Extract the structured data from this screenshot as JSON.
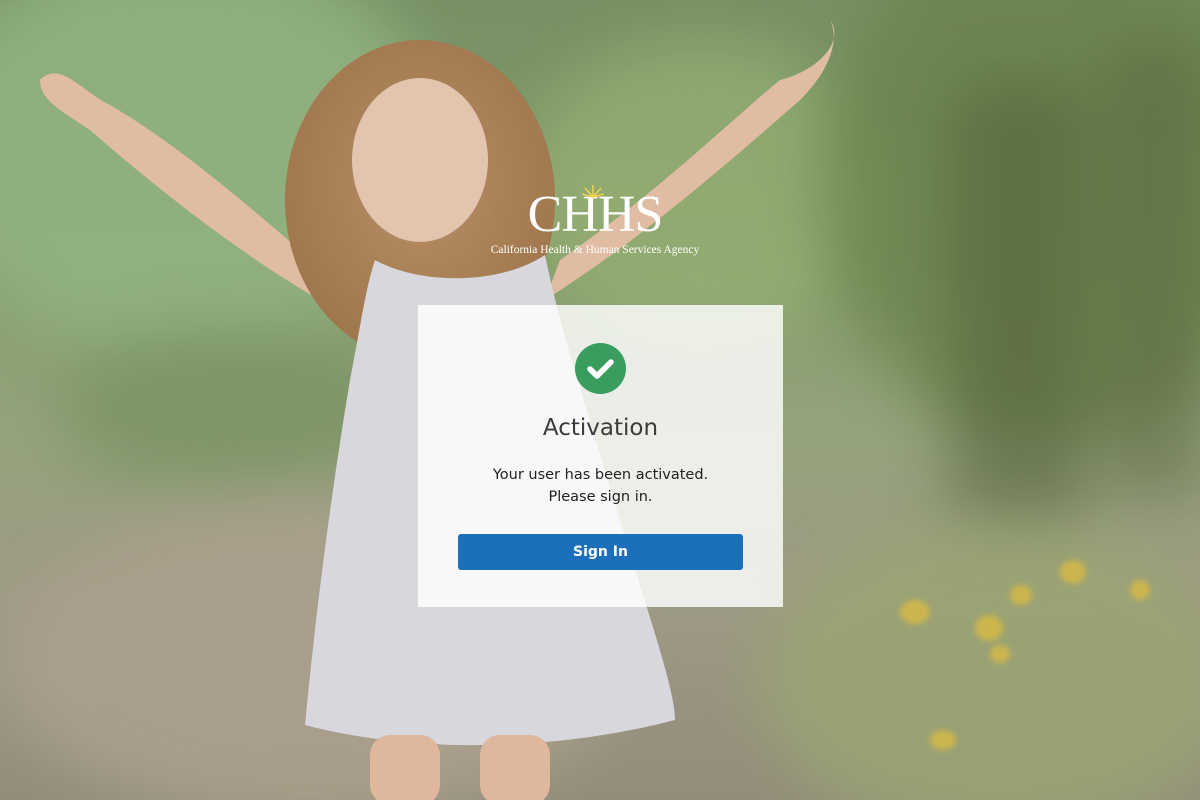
{
  "background": {
    "image": "child-in-forest-photo"
  },
  "logo": {
    "mark": "CHHS",
    "subtitle": "California Health & Human Services Agency"
  },
  "panel": {
    "icon": "check-circle-icon",
    "icon_color": "#3a9c5e",
    "title": "Activation",
    "message_line1": "Your user has been activated.",
    "message_line2": "Please sign in.",
    "button_label": "Sign In",
    "button_color": "#1c6fbb"
  }
}
